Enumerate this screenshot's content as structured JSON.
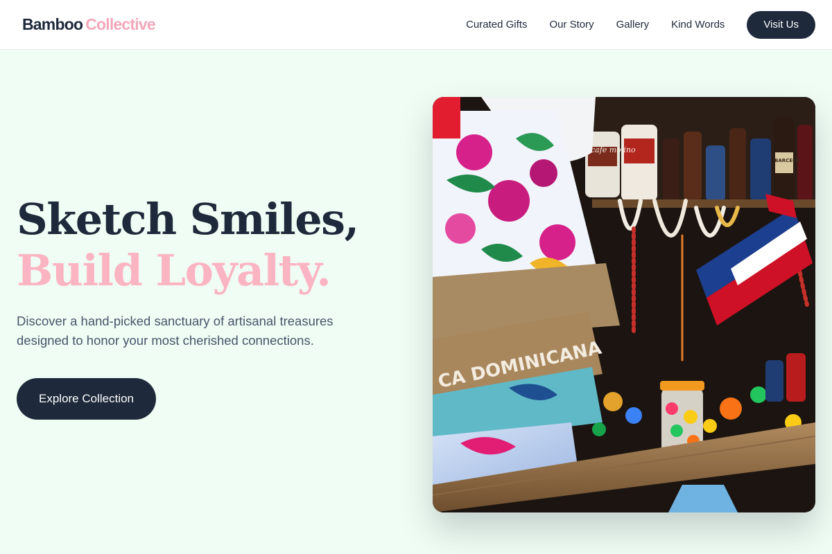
{
  "brand": {
    "name_part1": "Bamboo",
    "name_part2": "Collective",
    "color_primary": "#1e293b",
    "color_accent": "#f4a7b9"
  },
  "nav": {
    "links": [
      {
        "label": "Curated Gifts"
      },
      {
        "label": "Our Story"
      },
      {
        "label": "Gallery"
      },
      {
        "label": "Kind Words"
      }
    ],
    "cta_label": "Visit Us"
  },
  "hero": {
    "headline_line1": "Sketch Smiles,",
    "headline_line2": "Build Loyalty.",
    "subhead": "Discover a hand-picked sanctuary of artisanal treasures designed to honor your most cherished connections.",
    "cta_label": "Explore Collection",
    "image": {
      "subject": "market stall with colorful souvenirs, floral bags, shell necklaces and bottles",
      "visible_text": [
        "CA DOMINICANA",
        "cafe molino",
        "BARCELÓ"
      ]
    }
  },
  "colors": {
    "page_bg": "#f0fdf4",
    "dark": "#1e293b",
    "pink": "#fbb4c1",
    "muted": "#475569"
  }
}
